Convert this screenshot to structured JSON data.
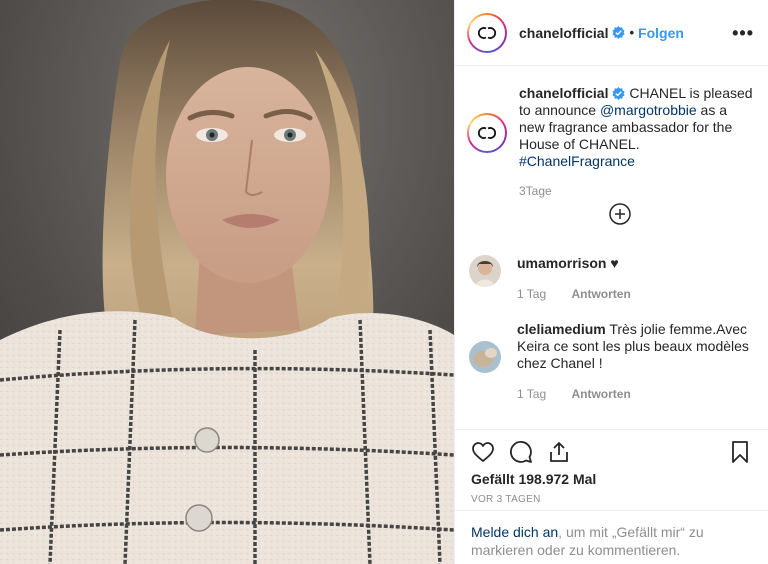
{
  "post": {
    "username": "chanelofficial",
    "follow_label": "Folgen",
    "dot": "•",
    "more": "•••"
  },
  "caption": {
    "username": "chanelofficial",
    "text_1": "CHANEL is pleased to announce ",
    "mention": "@margotrobbie",
    "text_2": " as a new fragrance ambassador for the House of CHANEL. ",
    "hashtag": "#ChanelFragrance",
    "time": "3Tage"
  },
  "comments": [
    {
      "username": "umamorrison",
      "text": " ♥",
      "time": "1 Tag",
      "reply": "Antworten"
    },
    {
      "username": "cleliamedium",
      "text": " Très jolie femme.Avec Keira ce sont les plus beaux modèles chez Chanel !",
      "time": "1 Tag",
      "reply": "Antworten"
    }
  ],
  "stats": {
    "likes": "Gefällt 198.972 Mal",
    "ago": "VOR 3 TAGEN"
  },
  "login": {
    "link": "Melde dich an",
    "text": ", um mit „Gefällt mir“ zu markieren oder zu kommentieren."
  },
  "icons": {
    "like": "heart-icon",
    "comment": "comment-icon",
    "share": "share-icon",
    "save": "bookmark-icon",
    "verified": "verified-badge-icon",
    "add": "plus-circle-icon"
  },
  "colors": {
    "accent": "#3897f0",
    "link": "#003569",
    "muted": "#8e8e8e",
    "text": "#262626"
  }
}
